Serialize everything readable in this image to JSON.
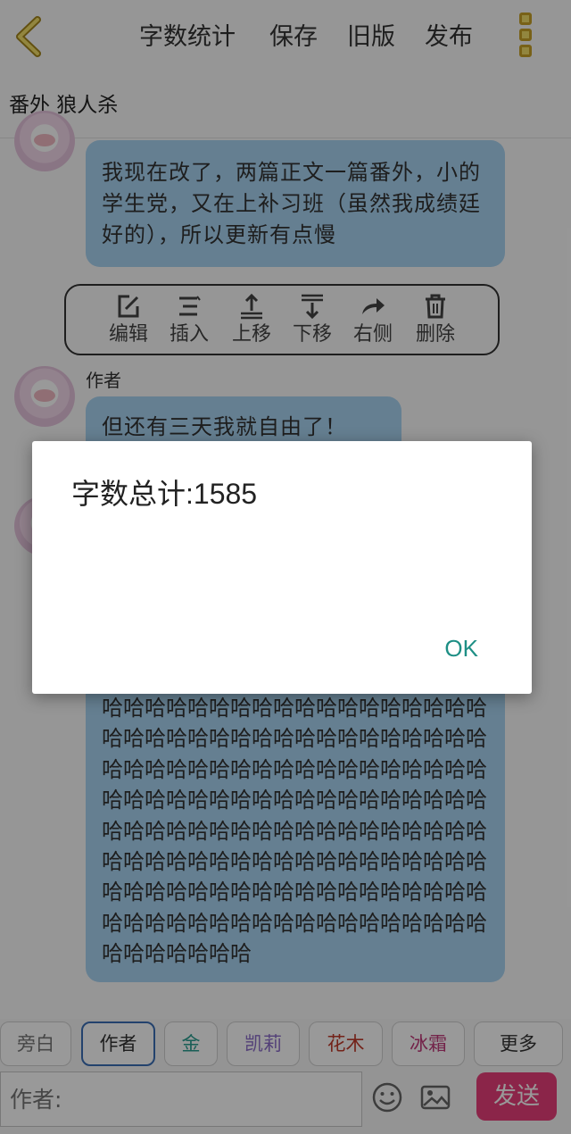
{
  "toolbar": {
    "word_count_label": "字数统计",
    "save_label": "保存",
    "old_version_label": "旧版",
    "publish_label": "发布"
  },
  "doc": {
    "title": "番外 狼人杀"
  },
  "messages": [
    {
      "text": "我现在改了，两篇正文一篇番外，小的学生党，又在上补习班（虽然我成绩廷好的），所以更新有点慢"
    },
    {
      "sender": "作者",
      "text": "但还有三天我就自由了！"
    },
    {
      "text": "哈哈哈哈哈哈哈哈哈哈哈哈哈哈哈哈哈哈哈哈哈哈哈哈哈哈哈哈哈哈哈哈哈哈哈哈哈哈哈哈哈哈哈哈哈哈哈哈哈哈哈哈哈哈哈哈哈哈哈哈哈哈哈哈哈哈哈哈哈哈哈哈哈哈哈哈哈哈哈哈哈哈哈哈哈哈哈哈哈哈哈哈哈哈哈哈哈哈哈哈哈哈哈哈哈哈哈哈哈哈哈哈哈哈哈哈哈哈哈哈哈哈哈哈哈哈哈哈哈哈哈哈哈哈哈哈哈哈哈哈哈哈哈哈哈哈哈哈哈哈哈"
    }
  ],
  "actions": {
    "edit": "编辑",
    "insert": "插入",
    "move_up": "上移",
    "move_down": "下移",
    "right_side": "右侧",
    "delete": "删除"
  },
  "dialog": {
    "message": "字数总计:1585",
    "ok_label": "OK"
  },
  "roles": [
    {
      "label": "旁白",
      "color": "#777777"
    },
    {
      "label": "作者",
      "color": "#333333",
      "active": true
    },
    {
      "label": "金",
      "color": "#2a9d8f"
    },
    {
      "label": "凯莉",
      "color": "#8a6cc9"
    },
    {
      "label": "花木",
      "color": "#c0392b"
    },
    {
      "label": "冰霜",
      "color": "#c0397a"
    },
    {
      "label": "更多",
      "color": "#333333"
    }
  ],
  "input": {
    "placeholder": "作者:"
  },
  "send_label": "发送",
  "colors": {
    "accent_send": "#e83f7a",
    "bubble": "#a8d4f2",
    "ok": "#1e8f85",
    "menu_icon": "#f3df6a"
  },
  "icons": [
    "back-icon",
    "more-menu-icon",
    "edit-icon",
    "insert-icon",
    "move-up-icon",
    "move-down-icon",
    "forward-icon",
    "trash-icon",
    "emoji-icon",
    "image-icon"
  ]
}
